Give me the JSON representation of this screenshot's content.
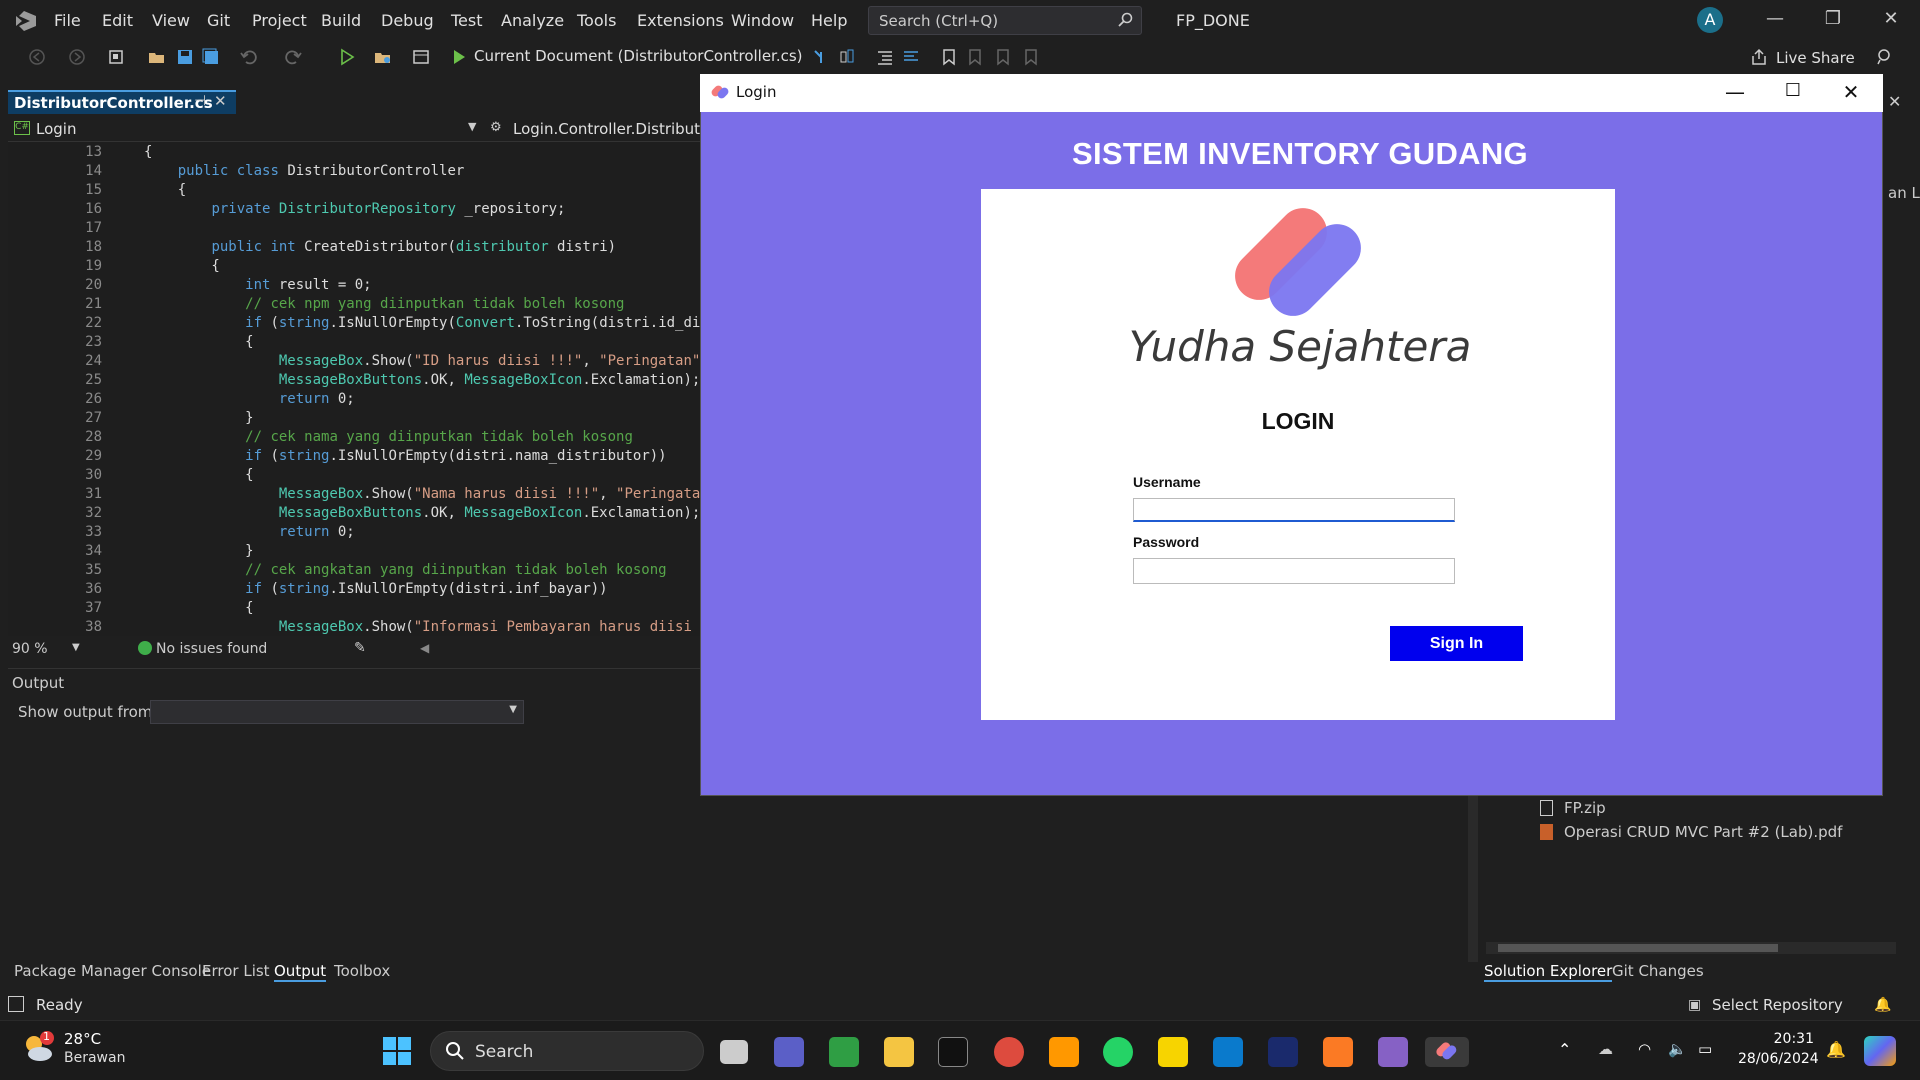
{
  "ide": {
    "menu": [
      "File",
      "Edit",
      "View",
      "Git",
      "Project",
      "Build",
      "Debug",
      "Test",
      "Analyze",
      "Tools",
      "Extensions",
      "Window",
      "Help"
    ],
    "search_placeholder": "Search (Ctrl+Q)",
    "solution_name": "FP_DONE",
    "avatar_initial": "A",
    "run_target": "Current Document (DistributorController.cs)",
    "live_share": "Live Share",
    "doc_tab": "DistributorController.cs",
    "nav_left": "Login",
    "nav_right": "Login.Controller.DistributorC",
    "zoom": "90 %",
    "issues": "No issues found",
    "output_title": "Output",
    "output_from_label": "Show output from:",
    "bottom_tabs": [
      "Package Manager Console",
      "Error List",
      "Output",
      "Toolbox"
    ],
    "solution_files": [
      "FP.zip",
      "Operasi CRUD MVC Part #2 (Lab).pdf"
    ],
    "solution_tabs": [
      "Solution Explorer",
      "Git Changes"
    ],
    "status_ready": "Ready",
    "select_repository": "Select Repository",
    "right_fragment_text": "an La"
  },
  "code": {
    "line_numbers": [
      "13",
      "14",
      "15",
      "16",
      "17",
      "18",
      "19",
      "20",
      "21",
      "22",
      "23",
      "24",
      "25",
      "26",
      "27",
      "28",
      "29",
      "30",
      "31",
      "32",
      "33",
      "34",
      "35",
      "36",
      "37",
      "38"
    ],
    "lines": [
      "{",
      "    public class DistributorController",
      "    {",
      "        private DistributorRepository _repository;",
      "",
      "        public int CreateDistributor(distributor distri)",
      "        {",
      "            int result = 0;",
      "            // cek npm yang diinputkan tidak boleh kosong",
      "            if (string.IsNullOrEmpty(Convert.ToString(distri.id_di",
      "            {",
      "                MessageBox.Show(\"ID harus diisi !!!\", \"Peringatan\"",
      "                MessageBoxButtons.OK, MessageBoxIcon.Exclamation);",
      "                return 0;",
      "            }",
      "            // cek nama yang diinputkan tidak boleh kosong",
      "            if (string.IsNullOrEmpty(distri.nama_distributor))",
      "            {",
      "                MessageBox.Show(\"Nama harus diisi !!!\", \"Peringata",
      "                MessageBoxButtons.OK, MessageBoxIcon.Exclamation);",
      "                return 0;",
      "            }",
      "            // cek angkatan yang diinputkan tidak boleh kosong",
      "            if (string.IsNullOrEmpty(distri.inf_bayar))",
      "            {",
      "                MessageBox.Show(\"Informasi Pembayaran harus diisi"
    ]
  },
  "login": {
    "window_title": "Login",
    "heading": "SISTEM INVENTORY GUDANG",
    "brand_name": "Yudha Sejahtera",
    "form_title": "LOGIN",
    "username_label": "Username",
    "username_value": "",
    "password_label": "Password",
    "password_value": "",
    "signin_label": "Sign In",
    "colors": {
      "background": "#7b6ee8",
      "button": "#0000ee",
      "logo_left": "#f47a7a",
      "logo_right": "#7b76f0"
    }
  },
  "taskbar": {
    "weather_temp": "28°C",
    "weather_desc": "Berawan",
    "weather_badge": "1",
    "search_label": "Search",
    "time": "20:31",
    "date": "28/06/2024",
    "apps": [
      "windows-start",
      "task-view",
      "teams",
      "excel-like",
      "file-explorer",
      "terminal",
      "chrome",
      "sublime-text",
      "whatsapp",
      "sticky-notes",
      "vscode",
      "powershell",
      "xampp",
      "visual-studio",
      "login-app"
    ]
  }
}
